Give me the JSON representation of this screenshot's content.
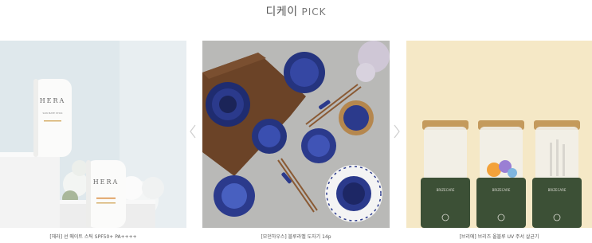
{
  "section": {
    "title_korean": "디케이",
    "title_pick": "PICK"
  },
  "products": [
    {
      "caption": "[헤라] 선 메이트 스틱 SPF50+ PA++++",
      "brand_text": "HERA",
      "product_text": "SUN MATE STICK"
    },
    {
      "caption": "[모던하우스] 블루라벨 도자기 14p"
    },
    {
      "caption": "[브리에] 브리즈 올블루 UV 주서 살균기",
      "brand_text": "BRIZECARE"
    }
  ],
  "navigation": {
    "prev_label": "‹",
    "next_label": "›"
  },
  "colors": {
    "card1_bg": "#dfe8ec",
    "card2_bg": "#b9b9b7",
    "card3_bg": "#f5e8c6",
    "ceramic_blue": "#2b3a8c",
    "sterilizer_green": "#3c5036",
    "wood": "#6b4327"
  },
  "icons": {
    "prev": "chevron-left-icon",
    "next": "chevron-right-icon"
  }
}
